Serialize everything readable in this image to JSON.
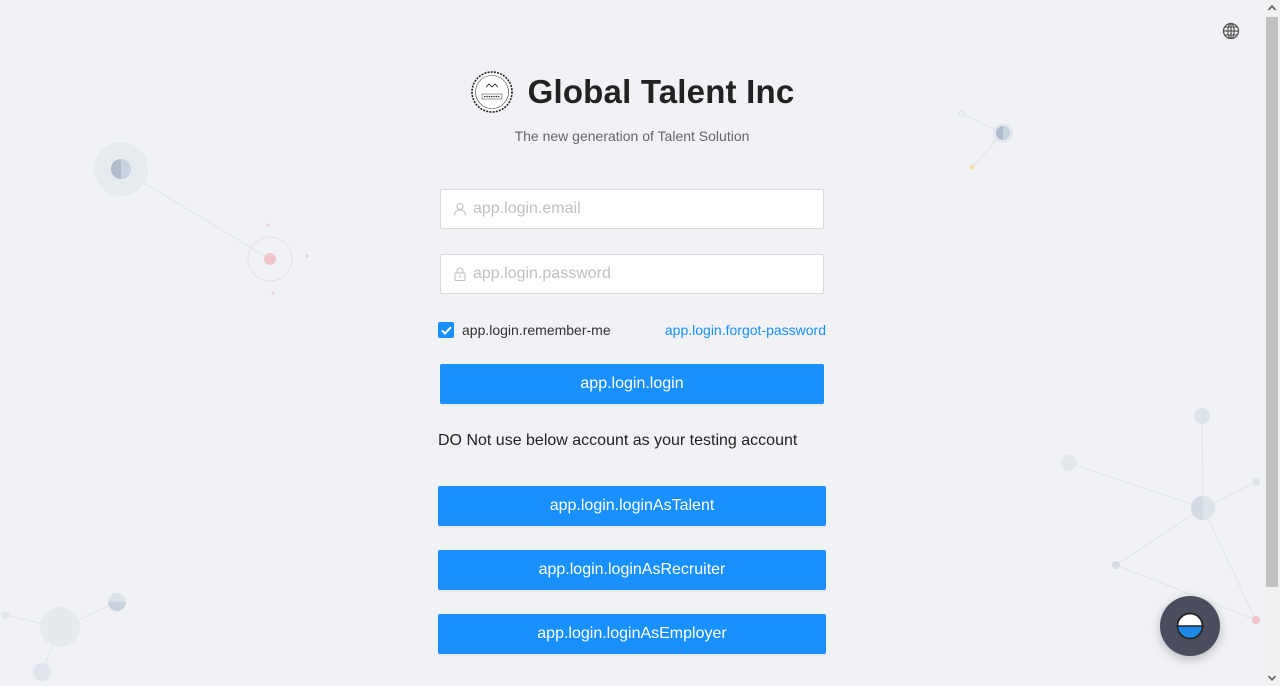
{
  "header": {
    "title": "Global Talent Inc",
    "subtitle": "The new generation of Talent Solution"
  },
  "form": {
    "email_placeholder": "app.login.email",
    "password_placeholder": "app.login.password",
    "remember_me_label": "app.login.remember-me",
    "remember_me_checked": true,
    "forgot_password_label": "app.login.forgot-password",
    "login_button_label": "app.login.login"
  },
  "demo_accounts": {
    "notice": "DO Not use below account as your testing account",
    "talent_label": "app.login.loginAsTalent",
    "recruiter_label": "app.login.loginAsRecruiter",
    "employer_label": "app.login.loginAsEmployer"
  },
  "icons": {
    "language": "globe-icon",
    "email_prefix": "user-icon",
    "password_prefix": "lock-icon",
    "chat": "chat-bot-icon"
  },
  "colors": {
    "primary": "#1890ff",
    "background": "#f0f2f5",
    "fab": "#4a4d5e"
  }
}
